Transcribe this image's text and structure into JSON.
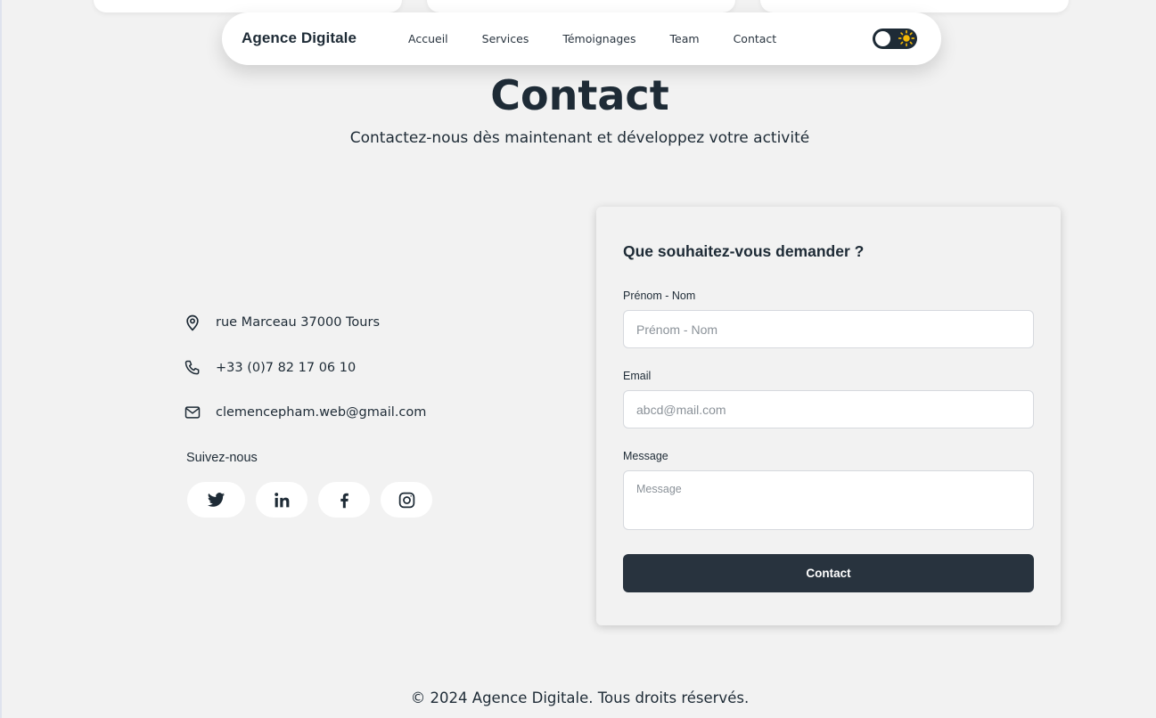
{
  "nav": {
    "brand": "Agence Digitale",
    "links": [
      "Accueil",
      "Services",
      "Témoignages",
      "Team",
      "Contact"
    ]
  },
  "header": {
    "title": "Contact",
    "subtitle": "Contactez-nous dès maintenant et développez votre activité"
  },
  "info": {
    "address": "rue Marceau 37000 Tours",
    "phone": "+33 (0)7 82 17 06 10",
    "email": "clemencepham.web@gmail.com",
    "follow_label": "Suivez-nous",
    "socials": [
      "twitter-icon",
      "linkedin-icon",
      "facebook-icon",
      "instagram-icon"
    ]
  },
  "form": {
    "title": "Que souhaitez-vous demander ?",
    "name_label": "Prénom - Nom",
    "name_placeholder": "Prénom - Nom",
    "email_label": "Email",
    "email_placeholder": "abcd@mail.com",
    "message_label": "Message",
    "message_placeholder": "Message",
    "submit_label": "Contact"
  },
  "footer": {
    "copyright": "© 2024 Agence Digitale. Tous droits réservés."
  },
  "colors": {
    "background": "#f2f2f2",
    "text": "#1e2b36",
    "button": "#28333e",
    "sun": "#f2b705"
  }
}
